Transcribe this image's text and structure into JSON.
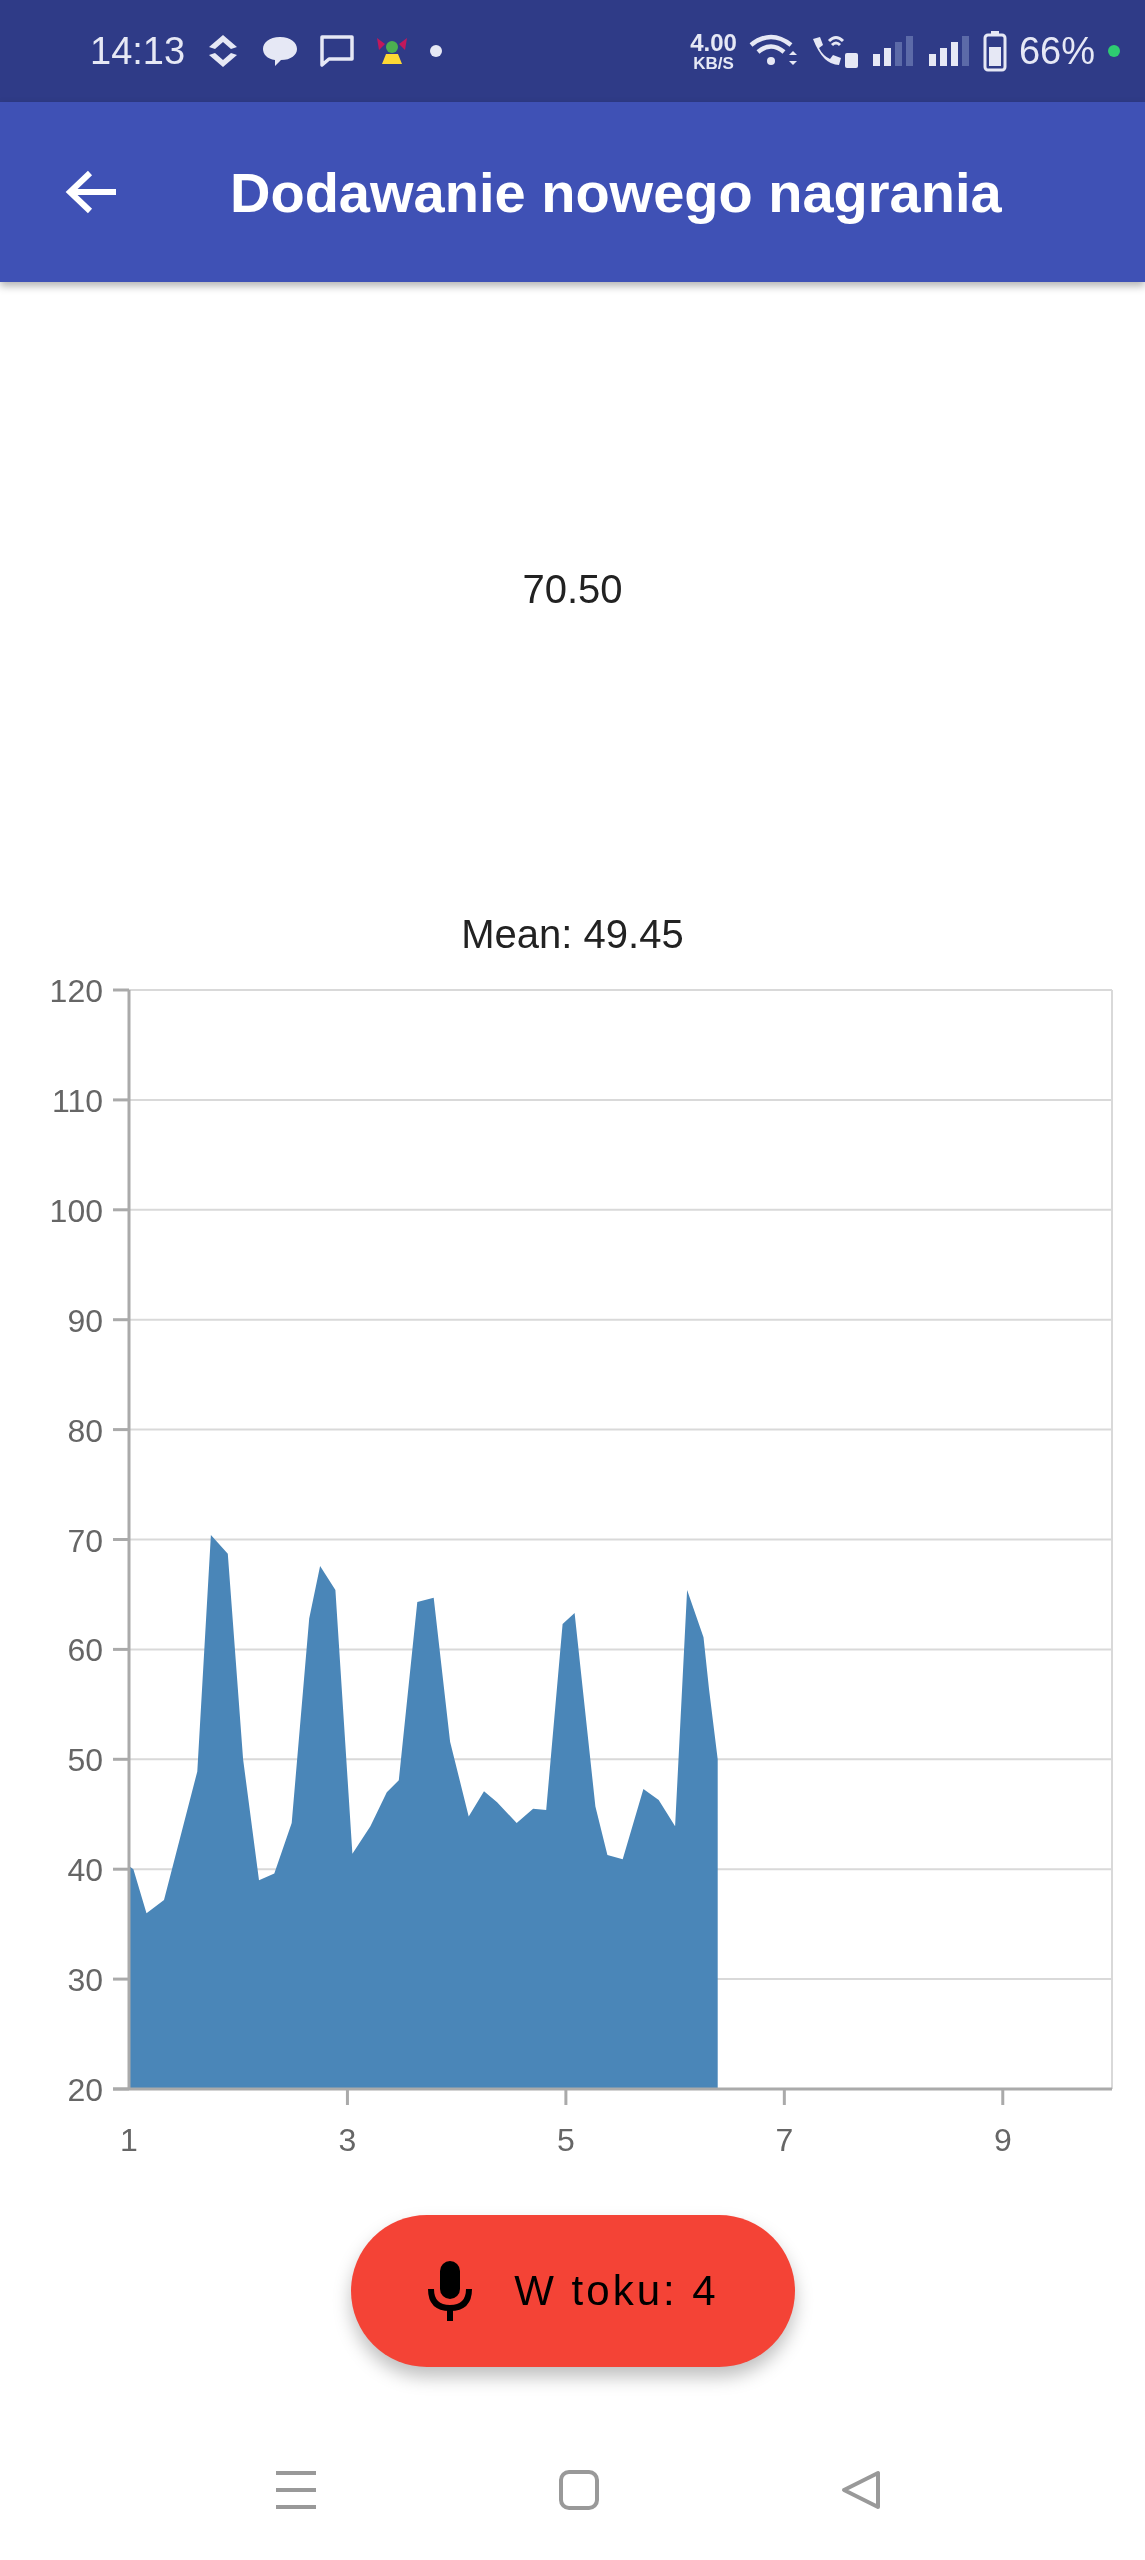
{
  "status_bar": {
    "time": "14:13",
    "net_speed": "4.00",
    "net_unit": "KB/S",
    "battery": "66%"
  },
  "app_bar": {
    "title": "Dodawanie nowego nagrania"
  },
  "current_value": "70.50",
  "chart": {
    "chart_data": {
      "type": "area",
      "title": "Mean: 49.45",
      "xlim": [
        1,
        10
      ],
      "ylim": [
        20,
        120
      ],
      "xticks": [
        1,
        3,
        5,
        7,
        9
      ],
      "yticks": [
        20,
        30,
        40,
        50,
        60,
        70,
        80,
        90,
        100,
        110,
        120
      ],
      "x": [
        1.0,
        1.04,
        1.16,
        1.32,
        1.625,
        1.75,
        1.905,
        2.045,
        2.19,
        2.33,
        2.49,
        2.65,
        2.75,
        2.89,
        3.045,
        3.21,
        3.36,
        3.47,
        3.64,
        3.79,
        3.94,
        4.11,
        4.25,
        4.37,
        4.55,
        4.7,
        4.82,
        4.97,
        5.08,
        5.27,
        5.38,
        5.52,
        5.71,
        5.85,
        6.0,
        6.11,
        6.26,
        6.31,
        6.39
      ],
      "grid": true,
      "series": [
        {
          "color": "#4a86b8",
          "values": [
            40.3,
            40.0,
            36.0,
            37.2,
            48.9,
            70.4,
            68.7,
            50.0,
            39.0,
            39.6,
            44.2,
            62.8,
            67.6,
            65.4,
            41.4,
            43.9,
            47.0,
            48.1,
            64.3,
            64.7,
            51.6,
            44.8,
            47.1,
            46.1,
            44.2,
            45.5,
            45.4,
            62.3,
            63.3,
            45.7,
            41.3,
            40.9,
            47.3,
            46.3,
            43.9,
            65.4,
            61.1,
            56.4,
            50.0
          ]
        }
      ]
    }
  },
  "record_button": {
    "label": "W toku: 4"
  }
}
